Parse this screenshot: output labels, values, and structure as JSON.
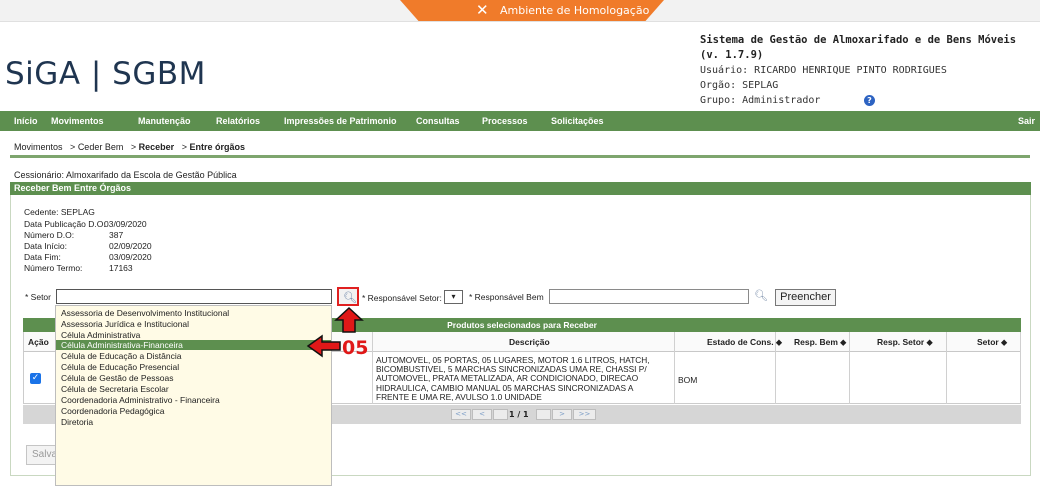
{
  "environment": {
    "label": "Ambiente de Homologação"
  },
  "logo": {
    "text": "SiGA | SGBM"
  },
  "system": {
    "title": "Sistema de Gestão de Almoxarifado e de Bens Móveis (v. 1.7.9)",
    "usuario": "Usuário: RICARDO HENRIQUE PINTO RODRIGUES",
    "orgao": "Orgão: SEPLAG",
    "grupo": "Grupo: Administrador"
  },
  "menu": {
    "items": [
      "Início",
      "Movimentos",
      "Manutenção",
      "Relatórios",
      "Impressões de Patrimonio",
      "Consultas",
      "Processos",
      "Solicitações"
    ],
    "logout": "Sair"
  },
  "breadcrumb": {
    "path": [
      "Movimentos",
      "Ceder Bem",
      "Receber",
      "Entre órgãos"
    ],
    "separator": ">"
  },
  "cessionario": "Cessionário: Almoxarifado da Escola de Gestão Pública",
  "panel": {
    "title": "Receber Bem Entre Órgãos"
  },
  "info": {
    "cedente": "Cedente: SEPLAG",
    "data_publicacao_label": "Data Publicação D.O:",
    "data_publicacao": "03/09/2020",
    "numero_do_label": "Número D.O:",
    "numero_do": "387",
    "data_inicio_label": "Data Início:",
    "data_inicio": "02/09/2020",
    "data_fim_label": "Data Fim:",
    "data_fim": "03/09/2020",
    "numero_termo_label": "Número Termo:",
    "numero_termo": "17163"
  },
  "form": {
    "setor_label": "* Setor",
    "setor_value": "",
    "responsavel_setor_label": "* Responsável Setor:",
    "responsavel_setor_select": "▾",
    "responsavel_bem_label": "* Responsável Bem",
    "responsavel_bem_value": "",
    "preencher_label": "Preencher"
  },
  "dropdown": {
    "options": [
      "Assessoria de Desenvolvimento Institucional",
      "Assessoria Jurídica e Institucional",
      "Célula Administrativa",
      "Célula Administrativa-Financeira",
      "Célula de Educação a Distância",
      "Célula de Educação Presencial",
      "Célula de Gestão de Pessoas",
      "Célula de Secretaria Escolar",
      "Coordenadoria Administrativo - Financeira",
      "Coordenadoria Pedagógica",
      "Diretoria"
    ],
    "selected_index": 3
  },
  "table": {
    "title": "Produtos selecionados para Receber",
    "columns": {
      "acao": "Ação",
      "descricao": "Descrição",
      "estado": "Estado de Cons. ⬥",
      "resp_bem": "Resp. Bem ⬥",
      "resp_setor": "Resp. Setor ⬥",
      "setor": "Setor ⬥"
    },
    "row": {
      "checked": "✓",
      "descricao_lines": [
        "AUTOMOVEL, 05 PORTAS, 05 LUGARES, MOTOR 1.6 LITROS, HATCH,",
        "BICOMBUSTIVEL, 5 MARCHAS SINCRONIZADAS UMA RE, CHASSI P/",
        "AUTOMOVEL, PRATA METALIZADA, AR CONDICIONADO, DIRECAO",
        "HIDRAULICA, CAMBIO MANUAL 05 MARCHAS SINCRONIZADAS A",
        "FRENTE E UMA RE, AVULSO 1.0 UNIDADE"
      ],
      "estado": "BOM"
    },
    "pager": {
      "first": "<<",
      "prev": "<",
      "page": "1 / 1",
      "next": ">",
      "last": ">>"
    }
  },
  "actions": {
    "salvar": "Salvar"
  },
  "annotation": {
    "step": "05"
  },
  "colors": {
    "menu_green": "#5d8f4f",
    "env_orange": "#f07b2a",
    "annotation_red": "#e01818",
    "dropdown_bg": "#fffbe6"
  }
}
